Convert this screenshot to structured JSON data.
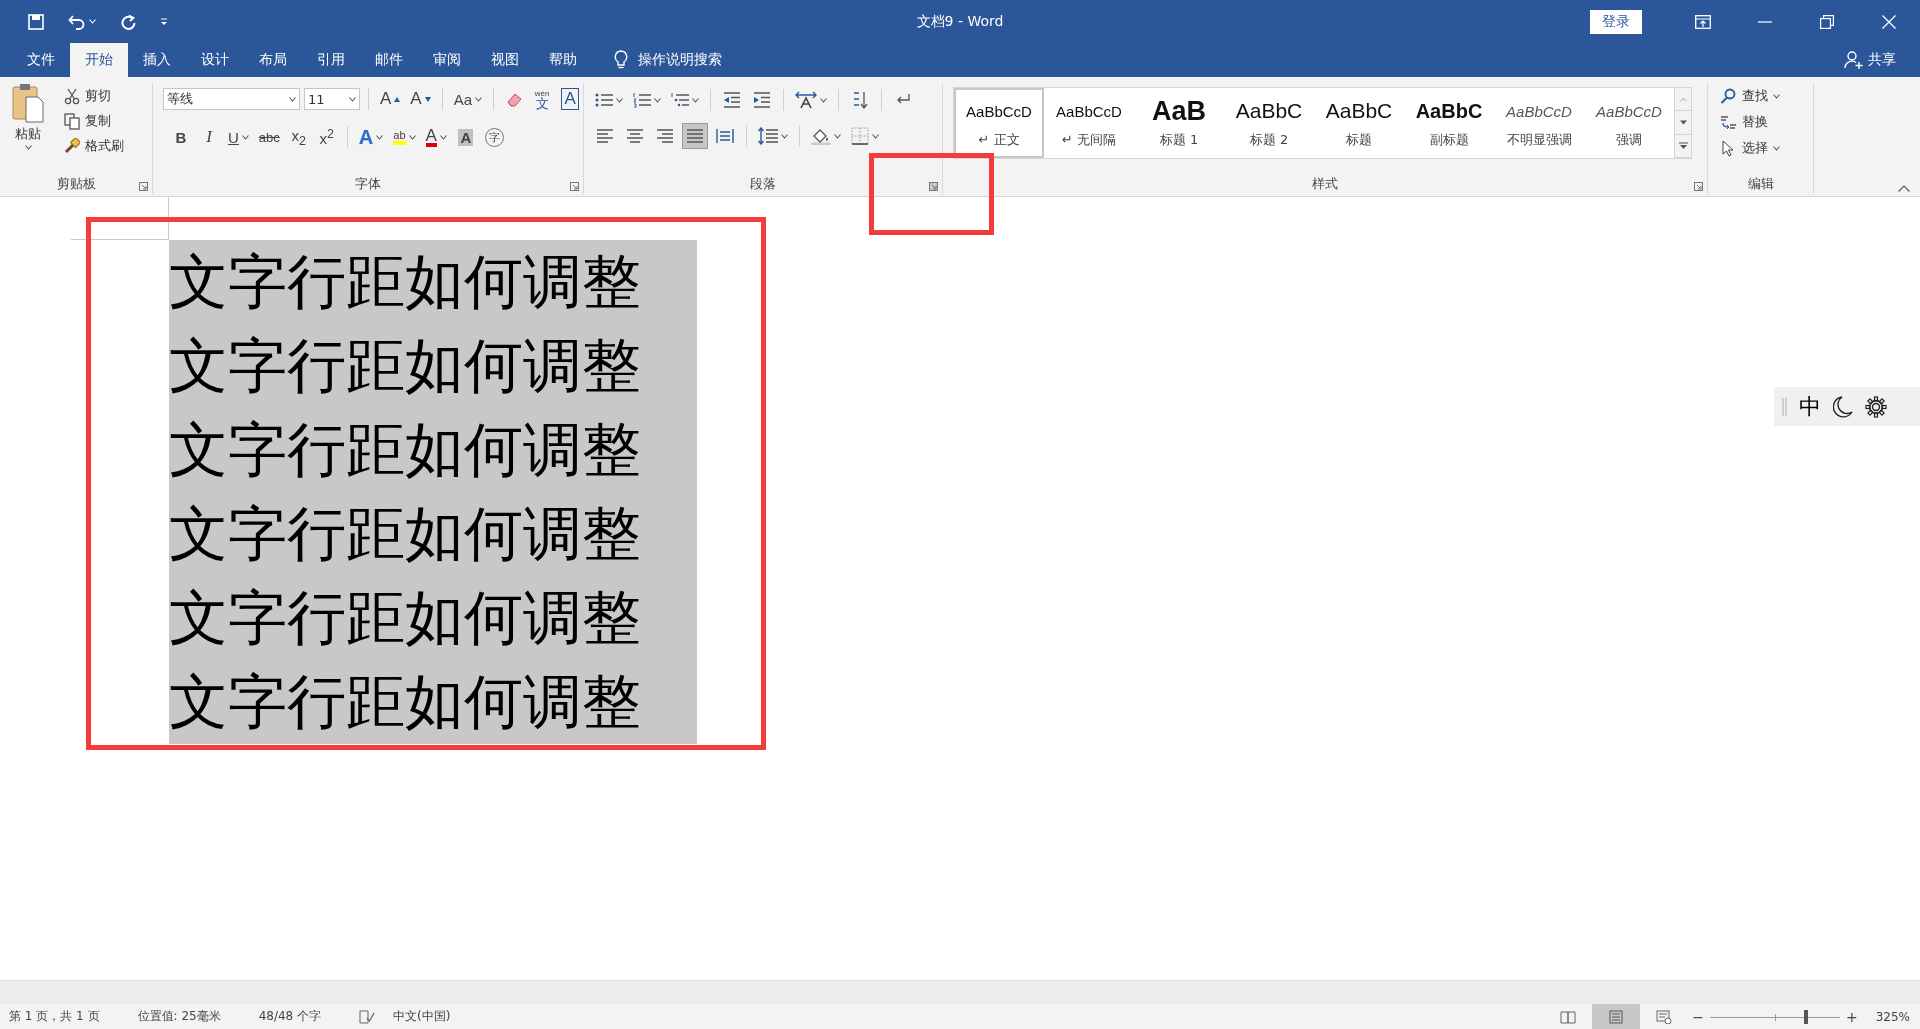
{
  "title_bar": {
    "title": "文档9  -  Word",
    "sign_in": "登录"
  },
  "tabs": [
    {
      "label": "文件",
      "selected": false
    },
    {
      "label": "开始",
      "selected": true
    },
    {
      "label": "插入",
      "selected": false
    },
    {
      "label": "设计",
      "selected": false
    },
    {
      "label": "布局",
      "selected": false
    },
    {
      "label": "引用",
      "selected": false
    },
    {
      "label": "邮件",
      "selected": false
    },
    {
      "label": "审阅",
      "selected": false
    },
    {
      "label": "视图",
      "selected": false
    },
    {
      "label": "帮助",
      "selected": false
    }
  ],
  "tell_me": "操作说明搜索",
  "share": "共享",
  "clipboard": {
    "label": "剪贴板",
    "paste": "粘贴",
    "commands": [
      {
        "kind": "cut",
        "label": "剪切"
      },
      {
        "kind": "copy",
        "label": "复制"
      },
      {
        "kind": "painter",
        "label": "格式刷"
      }
    ]
  },
  "font": {
    "label": "字体",
    "font_name": "等线",
    "font_size": "11",
    "row1": [
      {
        "kind": "grow",
        "text": "A"
      },
      {
        "kind": "shrink",
        "text": "A"
      },
      {
        "kind": "case",
        "text": "Aa"
      },
      {
        "kind": "clear"
      },
      {
        "kind": "phonetic",
        "ruby": "wén",
        "text": "文"
      },
      {
        "kind": "border",
        "text": "A"
      }
    ],
    "row2": [
      {
        "kind": "bold",
        "text": "B"
      },
      {
        "kind": "italic",
        "text": "I"
      },
      {
        "kind": "underline",
        "text": "U"
      },
      {
        "kind": "strike",
        "text": "abc"
      },
      {
        "kind": "sub",
        "text": "x$_{2}$"
      },
      {
        "kind": "sup",
        "text": "x$^{2}$"
      },
      {
        "kind": "effects",
        "text": "A"
      },
      {
        "kind": "highlight",
        "text": "ab"
      },
      {
        "kind": "color",
        "text": "A"
      },
      {
        "kind": "shading",
        "text": "A"
      },
      {
        "kind": "enclose",
        "text": "字"
      }
    ]
  },
  "paragraph": {
    "label": "段落",
    "alignment": [
      {
        "kind": "left",
        "selected": false
      },
      {
        "kind": "center",
        "selected": false
      },
      {
        "kind": "right",
        "selected": false
      },
      {
        "kind": "justify",
        "selected": true
      },
      {
        "kind": "distributed",
        "selected": false
      }
    ]
  },
  "styles": {
    "label": "样式",
    "items": [
      {
        "kind": "normal",
        "preview": "AaBbCcD",
        "name": "↵ 正文",
        "selected": true
      },
      {
        "kind": "normal",
        "preview": "AaBbCcD",
        "name": "↵ 无间隔",
        "selected": false
      },
      {
        "kind": "heading1",
        "preview": "AaB",
        "name": "标题 1",
        "selected": false
      },
      {
        "kind": "heading2",
        "preview": "AaBbC",
        "name": "标题 2",
        "selected": false
      },
      {
        "kind": "title",
        "preview": "AaBbC",
        "name": "标题",
        "selected": false
      },
      {
        "kind": "subtitle",
        "preview": "AaBbC",
        "name": "副标题",
        "selected": false
      },
      {
        "kind": "emphasis",
        "preview": "AaBbCcD",
        "name": "不明显强调",
        "selected": false
      },
      {
        "kind": "emphasis",
        "preview": "AaBbCcD",
        "name": "强调",
        "selected": false
      }
    ]
  },
  "editing": {
    "label": "编辑",
    "commands": [
      {
        "kind": "find",
        "label": "查找"
      },
      {
        "kind": "replace",
        "label": "替换"
      },
      {
        "kind": "select",
        "label": "选择"
      }
    ]
  },
  "document": {
    "selected": true,
    "lines": [
      "文字行距如何调整",
      "文字行距如何调整",
      "文字行距如何调整",
      "文字行距如何调整",
      "文字行距如何调整",
      "文字行距如何调整"
    ]
  },
  "ime_bar": {
    "mode": "中"
  },
  "status_bar": {
    "items": [
      "第 1 页，共 1 页",
      "位置值: 25毫米",
      "48/48 个字"
    ],
    "language": "中文(中国)",
    "views": [
      {
        "kind": "read",
        "selected": false
      },
      {
        "kind": "print",
        "selected": true
      },
      {
        "kind": "web",
        "selected": false
      }
    ],
    "zoom_out": "−",
    "zoom_in": "+",
    "zoom": {
      "level": 0.74
    },
    "zoom_text": "325%"
  },
  "annotations": [
    {
      "kind": "frame"
    },
    {
      "kind": "frame"
    }
  ]
}
